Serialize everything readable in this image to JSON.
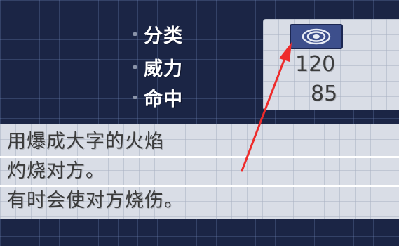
{
  "stats": {
    "category_label": "分类",
    "power_label": "威力",
    "accuracy_label": "命中",
    "category_icon": "special-category-icon",
    "power_value": "120",
    "accuracy_value": "85"
  },
  "description": {
    "lines": [
      "用爆成大字的火焰",
      "灼烧对方。",
      "有时会使对方烧伤。"
    ]
  },
  "colors": {
    "background": "#1b2545",
    "panel": "#d9dde6",
    "badge": "#3d4f8c",
    "arrow": "#ee2b2b"
  }
}
